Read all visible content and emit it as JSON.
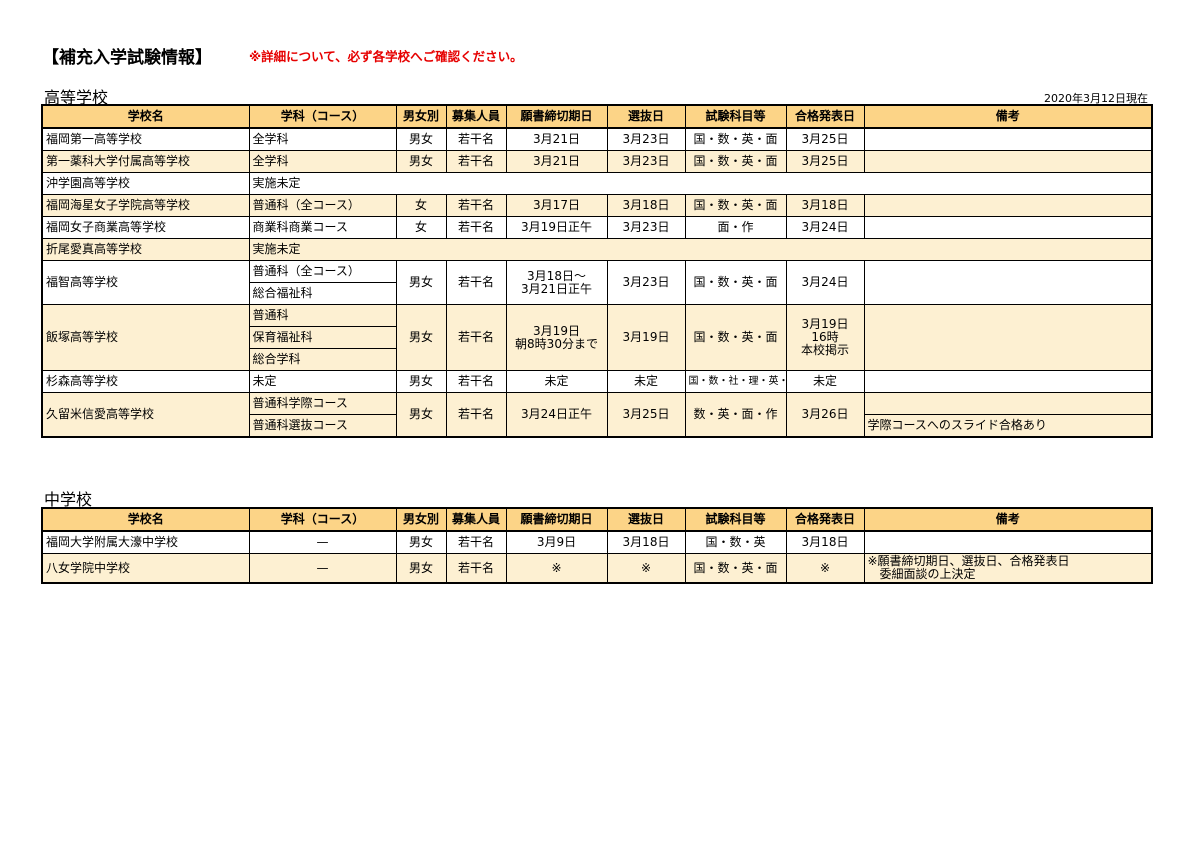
{
  "title": "【補充入学試験情報】",
  "notice": "※詳細について、必ず各学校へご確認ください。",
  "high": {
    "heading": "高等学校",
    "as_of": "2020年3月12日現在",
    "headers": [
      "学校名",
      "学科（コース）",
      "男女別",
      "募集人員",
      "願書締切期日",
      "選抜日",
      "試験科目等",
      "合格発表日",
      "備考"
    ],
    "rows": [
      {
        "school": "福岡第一高等学校",
        "dept": "全学科",
        "gender": "男女",
        "capacity": "若干名",
        "deadline": "3月21日",
        "exam": "3月23日",
        "subjects": "国・数・英・面",
        "result": "3月25日",
        "note": ""
      },
      {
        "school": "第一薬科大学付属高等学校",
        "dept": "全学科",
        "gender": "男女",
        "capacity": "若干名",
        "deadline": "3月21日",
        "exam": "3月23日",
        "subjects": "国・数・英・面",
        "result": "3月25日",
        "note": ""
      },
      {
        "school": "沖学園高等学校",
        "dept": "実施未定"
      },
      {
        "school": "福岡海星女子学院高等学校",
        "dept": "普通科（全コース）",
        "gender": "女",
        "capacity": "若干名",
        "deadline": "3月17日",
        "exam": "3月18日",
        "subjects": "国・数・英・面",
        "result": "3月18日",
        "note": ""
      },
      {
        "school": "福岡女子商業高等学校",
        "dept": "商業科商業コース",
        "gender": "女",
        "capacity": "若干名",
        "deadline": "3月19日正午",
        "exam": "3月23日",
        "subjects": "面・作",
        "result": "3月24日",
        "note": ""
      },
      {
        "school": "折尾愛真高等学校",
        "dept": "実施未定"
      },
      {
        "school": "福智高等学校",
        "depts": [
          "普通科（全コース）",
          "総合福祉科"
        ],
        "gender": "男女",
        "capacity": "若干名",
        "deadline_lines": [
          "3月18日～",
          "3月21日正午"
        ],
        "exam": "3月23日",
        "subjects": "国・数・英・面",
        "result": "3月24日",
        "note": ""
      },
      {
        "school": "飯塚高等学校",
        "depts": [
          "普通科",
          "保育福祉科",
          "総合学科"
        ],
        "gender": "男女",
        "capacity": "若干名",
        "deadline_lines": [
          "3月19日",
          "朝8時30分まで"
        ],
        "exam": "3月19日",
        "subjects": "国・数・英・面",
        "result_lines": [
          "3月19日",
          "16時",
          "本校掲示"
        ],
        "note": ""
      },
      {
        "school": "杉森高等学校",
        "dept": "未定",
        "gender": "男女",
        "capacity": "若干名",
        "deadline": "未定",
        "exam": "未定",
        "subjects": "国・数・社・理・英・面",
        "result": "未定",
        "note": ""
      },
      {
        "school": "久留米信愛高等学校",
        "depts": [
          "普通科学際コース",
          "普通科選抜コース"
        ],
        "gender": "男女",
        "capacity": "若干名",
        "deadline": "3月24日正午",
        "exam": "3月25日",
        "subjects": "数・英・面・作",
        "result": "3月26日",
        "notes": [
          "",
          "学際コースへのスライド合格あり"
        ]
      }
    ]
  },
  "middle": {
    "heading": "中学校",
    "headers": [
      "学校名",
      "学科（コース）",
      "男女別",
      "募集人員",
      "願書締切期日",
      "選抜日",
      "試験科目等",
      "合格発表日",
      "備考"
    ],
    "rows": [
      {
        "school": "福岡大学附属大濠中学校",
        "dept": "—",
        "gender": "男女",
        "capacity": "若干名",
        "deadline": "3月9日",
        "exam": "3月18日",
        "subjects": "国・数・英",
        "result": "3月18日",
        "note": ""
      },
      {
        "school": "八女学院中学校",
        "dept": "—",
        "gender": "男女",
        "capacity": "若干名",
        "deadline": "※",
        "exam": "※",
        "subjects": "国・数・英・面",
        "result": "※",
        "note_lines": [
          "※願書締切期日、選抜日、合格発表日",
          "委細面談の上決定"
        ]
      }
    ]
  }
}
